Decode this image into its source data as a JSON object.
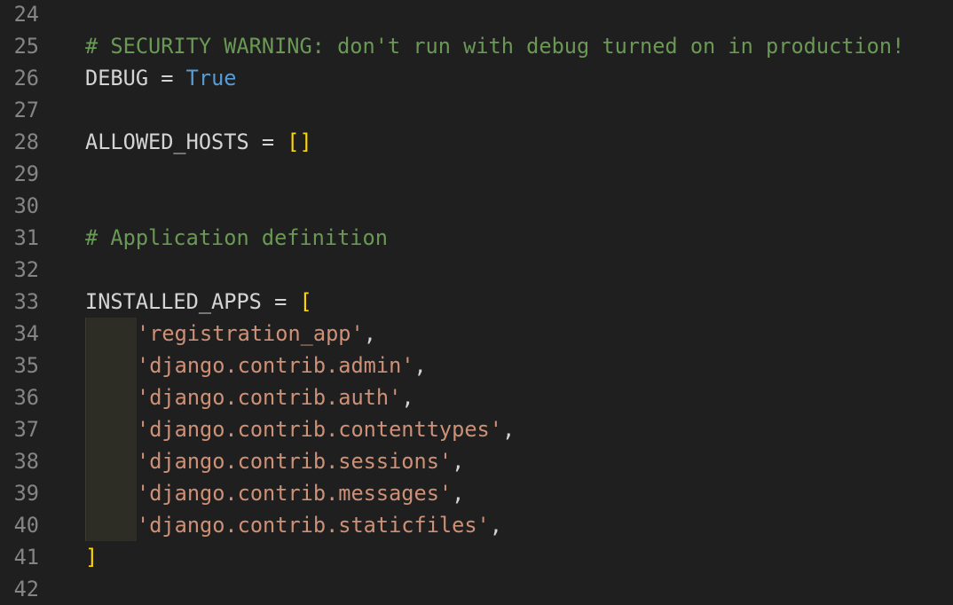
{
  "editor": {
    "lines": [
      {
        "number": "24",
        "tokens": []
      },
      {
        "number": "25",
        "tokens": [
          {
            "type": "comment",
            "text": "# SECURITY WARNING: don't run with debug turned on in production!"
          }
        ]
      },
      {
        "number": "26",
        "tokens": [
          {
            "type": "ident",
            "text": "DEBUG"
          },
          {
            "type": "op",
            "text": " = "
          },
          {
            "type": "keyword",
            "text": "True"
          }
        ]
      },
      {
        "number": "27",
        "tokens": []
      },
      {
        "number": "28",
        "tokens": [
          {
            "type": "ident",
            "text": "ALLOWED_HOSTS"
          },
          {
            "type": "op",
            "text": " = "
          },
          {
            "type": "bracket",
            "text": "[]"
          }
        ]
      },
      {
        "number": "29",
        "tokens": []
      },
      {
        "number": "30",
        "tokens": []
      },
      {
        "number": "31",
        "tokens": [
          {
            "type": "comment",
            "text": "# Application definition"
          }
        ]
      },
      {
        "number": "32",
        "tokens": []
      },
      {
        "number": "33",
        "tokens": [
          {
            "type": "ident",
            "text": "INSTALLED_APPS"
          },
          {
            "type": "op",
            "text": " = "
          },
          {
            "type": "bracket",
            "text": "["
          }
        ]
      },
      {
        "number": "34",
        "indent": true,
        "tokens": [
          {
            "type": "string",
            "text": "'registration_app'"
          },
          {
            "type": "punct",
            "text": ","
          }
        ]
      },
      {
        "number": "35",
        "indent": true,
        "tokens": [
          {
            "type": "string",
            "text": "'django.contrib.admin'"
          },
          {
            "type": "punct",
            "text": ","
          }
        ]
      },
      {
        "number": "36",
        "indent": true,
        "tokens": [
          {
            "type": "string",
            "text": "'django.contrib.auth'"
          },
          {
            "type": "punct",
            "text": ","
          }
        ]
      },
      {
        "number": "37",
        "indent": true,
        "tokens": [
          {
            "type": "string",
            "text": "'django.contrib.contenttypes'"
          },
          {
            "type": "punct",
            "text": ","
          }
        ]
      },
      {
        "number": "38",
        "indent": true,
        "tokens": [
          {
            "type": "string",
            "text": "'django.contrib.sessions'"
          },
          {
            "type": "punct",
            "text": ","
          }
        ]
      },
      {
        "number": "39",
        "indent": true,
        "tokens": [
          {
            "type": "string",
            "text": "'django.contrib.messages'"
          },
          {
            "type": "punct",
            "text": ","
          }
        ]
      },
      {
        "number": "40",
        "indent": true,
        "tokens": [
          {
            "type": "string",
            "text": "'django.contrib.staticfiles'"
          },
          {
            "type": "punct",
            "text": ","
          }
        ]
      },
      {
        "number": "41",
        "tokens": [
          {
            "type": "bracket",
            "text": "]"
          }
        ]
      },
      {
        "number": "42",
        "tokens": []
      }
    ]
  },
  "colors": {
    "background": "#1f1f1f",
    "line_number": "#858585",
    "comment": "#6a9955",
    "keyword": "#569cd6",
    "bracket": "#ffd700",
    "string": "#ce9178",
    "default": "#d4d4d4"
  }
}
